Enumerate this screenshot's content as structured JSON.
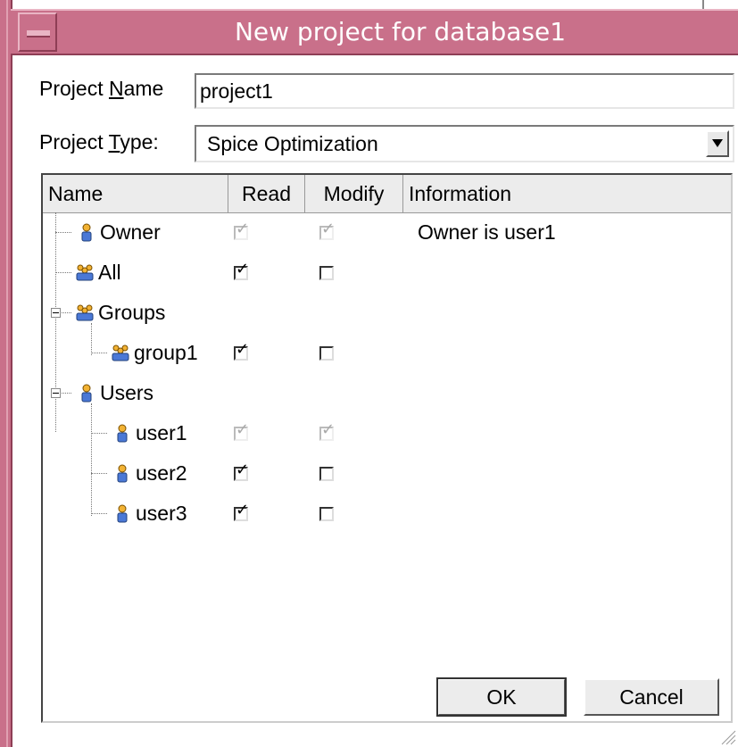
{
  "window": {
    "title": "New project for database1",
    "frame_color": "#c9708a"
  },
  "form": {
    "project_name_label_pre": "Project ",
    "project_name_label_u": "N",
    "project_name_label_post": "ame",
    "project_name_value": "project1",
    "project_type_label_pre": "Project ",
    "project_type_label_u": "T",
    "project_type_label_post": "ype:",
    "project_type_value": "Spice Optimization"
  },
  "table": {
    "columns": [
      "Name",
      "Read",
      "Modify",
      "Information"
    ],
    "rows": [
      {
        "name": "Owner",
        "icon": "user-icon",
        "read": true,
        "modify": true,
        "enabled": false,
        "info": "Owner is user1"
      },
      {
        "name": "All",
        "icon": "group-icon",
        "read": true,
        "modify": false,
        "enabled": true,
        "info": ""
      },
      {
        "name": "Groups",
        "icon": "group-icon",
        "info": ""
      },
      {
        "name": "group1",
        "icon": "group-icon",
        "read": true,
        "modify": false,
        "enabled": true,
        "info": ""
      },
      {
        "name": "Users",
        "icon": "user-icon",
        "info": ""
      },
      {
        "name": "user1",
        "icon": "user-icon",
        "read": true,
        "modify": true,
        "enabled": false,
        "info": ""
      },
      {
        "name": "user2",
        "icon": "user-icon",
        "read": true,
        "modify": false,
        "enabled": true,
        "info": ""
      },
      {
        "name": "user3",
        "icon": "user-icon",
        "read": true,
        "modify": false,
        "enabled": true,
        "info": ""
      }
    ]
  },
  "buttons": {
    "ok": "OK",
    "cancel": "Cancel"
  }
}
